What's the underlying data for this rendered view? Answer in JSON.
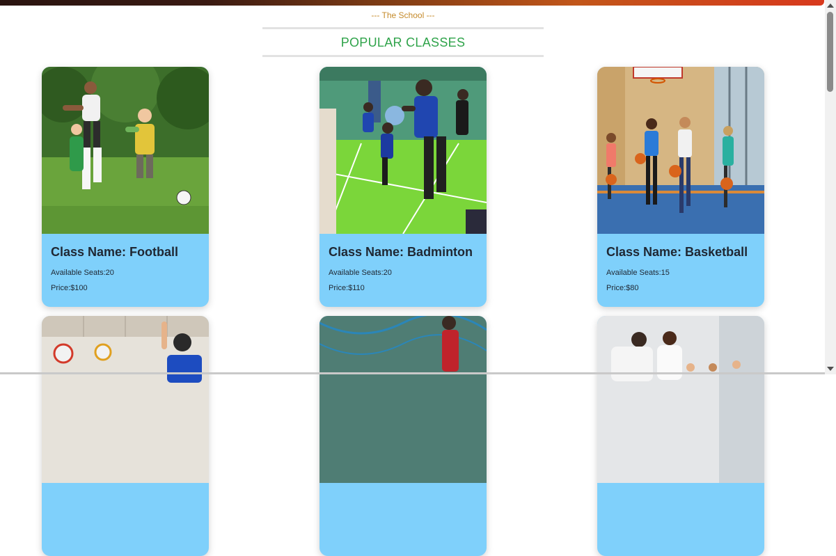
{
  "header": {
    "subtitle": "--- The School ---",
    "title": "POPULAR CLASSES"
  },
  "classes": [
    {
      "name": "Class Name: Football",
      "seats": "Available Seats:20",
      "price": "Price:$100"
    },
    {
      "name": "Class Name: Badminton",
      "seats": "Available Seats:20",
      "price": "Price:$110"
    },
    {
      "name": "Class Name: Basketball",
      "seats": "Available Seats:15",
      "price": "Price:$80"
    }
  ],
  "colors": {
    "card_info_bg": "#7fd0fb",
    "title": "#2fa34a",
    "subtitle": "#c58a2a"
  }
}
